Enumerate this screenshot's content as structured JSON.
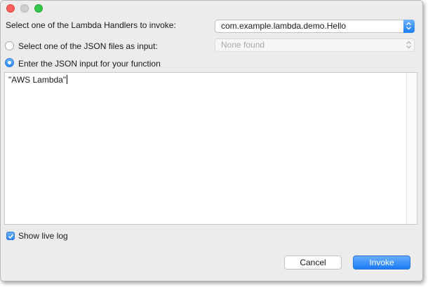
{
  "handler": {
    "label": "Select one of the Lambda Handlers to invoke:",
    "selected": "com.example.lambda.demo.Hello"
  },
  "json_file": {
    "label": "Select one of the JSON files as input:",
    "selected": "None found"
  },
  "json_input": {
    "label": "Enter the JSON input for your function",
    "value": "\"AWS Lambda\""
  },
  "live_log": {
    "label": "Show live log"
  },
  "buttons": {
    "cancel": "Cancel",
    "invoke": "Invoke"
  },
  "colors": {
    "accent": "#2a86f5",
    "window_bg": "#ececec"
  },
  "icons": {
    "select_stepper": "chevron-up-down-icon",
    "checkmark": "checkmark-icon"
  }
}
